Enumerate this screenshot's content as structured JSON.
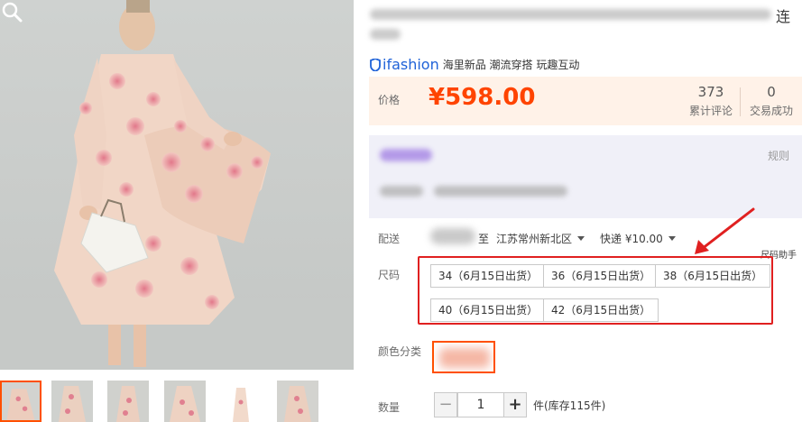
{
  "title": {
    "tail": "连"
  },
  "brand": {
    "logo_text": "ifashion",
    "tags": "海里新品 潮流穿搭 玩趣互动"
  },
  "price": {
    "label": "价格",
    "value": "¥598.00"
  },
  "stats": [
    {
      "num": "373",
      "label": "累计评论"
    },
    {
      "num": "0",
      "label": "交易成功"
    }
  ],
  "promo": {
    "rule": "规则"
  },
  "shipping": {
    "label": "配送",
    "to": "至",
    "area": "江苏常州新北区",
    "fee": "快递 ¥10.00"
  },
  "size": {
    "label": "尺码",
    "helper": "尺码助手",
    "options": [
      "34（6月15日出货）",
      "36（6月15日出货）",
      "38（6月15日出货）",
      "40（6月15日出货）",
      "42（6月15日出货）"
    ]
  },
  "color": {
    "label": "颜色分类"
  },
  "quantity": {
    "label": "数量",
    "value": "1",
    "minus": "−",
    "plus": "+",
    "stock": "件(库存115件)"
  },
  "colors": {
    "accent": "#ff5000",
    "price": "#ff4400",
    "highlight": "#e02020",
    "brand": "#1f62d8"
  },
  "icons": [
    "zoom-icon",
    "brand-logo-icon",
    "caret-down-icon",
    "red-arrow"
  ]
}
